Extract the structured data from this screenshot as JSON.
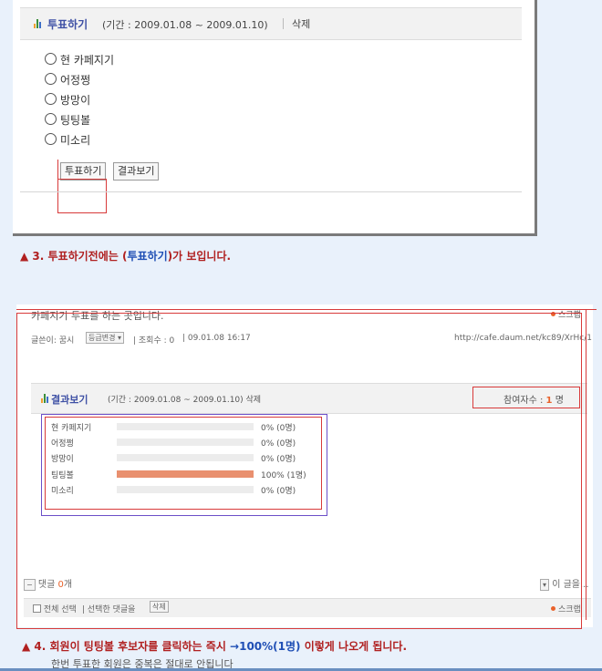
{
  "top_poll": {
    "title": "투표하기",
    "period": "(기간 : 2009.01.08 ~ 2009.01.10)",
    "delete_label": "삭제",
    "options": [
      "현 카페지기",
      "어정쩡",
      "방망이",
      "팅팅볼",
      "미소리"
    ],
    "vote_button": "투표하기",
    "result_button": "결과보기"
  },
  "caption_3": {
    "marker": "▲",
    "prefix": "3. 투표하기전에는 (",
    "highlight": "투표하기",
    "suffix": ")가 보입니다."
  },
  "post": {
    "title": "카페지기 투표를 하는 곳입니다.",
    "top_right_label": "스크랩",
    "author": "글쓴이: 꿈시",
    "grade_button": "등급변경",
    "views": "| 조회수 : 0",
    "datetime": "| 09.01.08 16:17",
    "url": "http://cafe.daum.net/kc89/XrHc/1"
  },
  "result_poll": {
    "title": "결과보기",
    "period": "(기간 : 2009.01.08 ~ 2009.01.10) 삭제",
    "participants_label": "참여자수 :",
    "participants_count": "1",
    "participants_unit": "명",
    "rows": [
      {
        "name": "현 카페지기",
        "percent": 0,
        "text": "0% (0명)"
      },
      {
        "name": "어정쩡",
        "percent": 0,
        "text": "0% (0명)"
      },
      {
        "name": "방망이",
        "percent": 0,
        "text": "0% (0명)"
      },
      {
        "name": "팅팅볼",
        "percent": 100,
        "text": "100% (1명)"
      },
      {
        "name": "미소리",
        "percent": 0,
        "text": "0% (0명)"
      }
    ],
    "bar_color": "#e9906f",
    "track_color": "#ececec"
  },
  "comments": {
    "label": "댓글",
    "count": "0",
    "unit": "개",
    "right_label": "이 글을..."
  },
  "footer": {
    "select_all": "전체 선택",
    "selected_reply": "| 선택한 댓글을",
    "delete_tag": "삭제",
    "right_label": "스크랩"
  },
  "caption_4": {
    "marker": "▲",
    "prefix": "4. 회원이 팅팅볼 후보자를 클릭하는 즉시 ",
    "highlight": "→100%(1명)",
    "suffix": " 이렇게 나오게 됩니다.",
    "line2": "한번 투표한 회원은 중복은 절대로 안됩니다"
  },
  "colors": {
    "accent_red": "#b02020",
    "accent_blue": "#1f4fb5",
    "annotation_red": "#d83a3a",
    "annotation_purple": "#6b4fc8"
  }
}
